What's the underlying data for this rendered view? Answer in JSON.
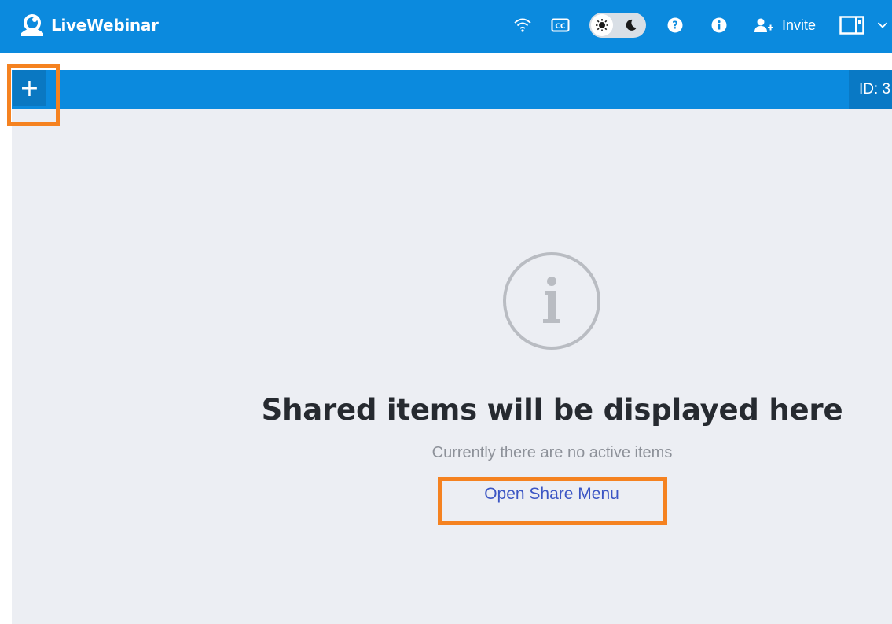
{
  "app": {
    "brand_name": "LiveWebinar",
    "brand_color": "#0b8ade"
  },
  "toolbar": {
    "icons": [
      "wifi-icon",
      "closed-captions-icon",
      "sun-icon",
      "moon-icon",
      "help-icon",
      "info-icon",
      "add-user-icon",
      "layout-icon",
      "chevron-down-icon"
    ],
    "cc_label": "CC",
    "invite_label": "Invite",
    "theme": "light"
  },
  "tabs": {
    "add_label": "+",
    "room_id": "ID: 3"
  },
  "empty_state": {
    "icon": "info-circle-icon",
    "title": "Shared items will be displayed here",
    "subtitle": "Currently there are no active items",
    "action_label": "Open Share Menu"
  },
  "highlights": {
    "color": "#f58220",
    "targets": [
      "add-tab-button",
      "open-share-menu-link"
    ]
  }
}
